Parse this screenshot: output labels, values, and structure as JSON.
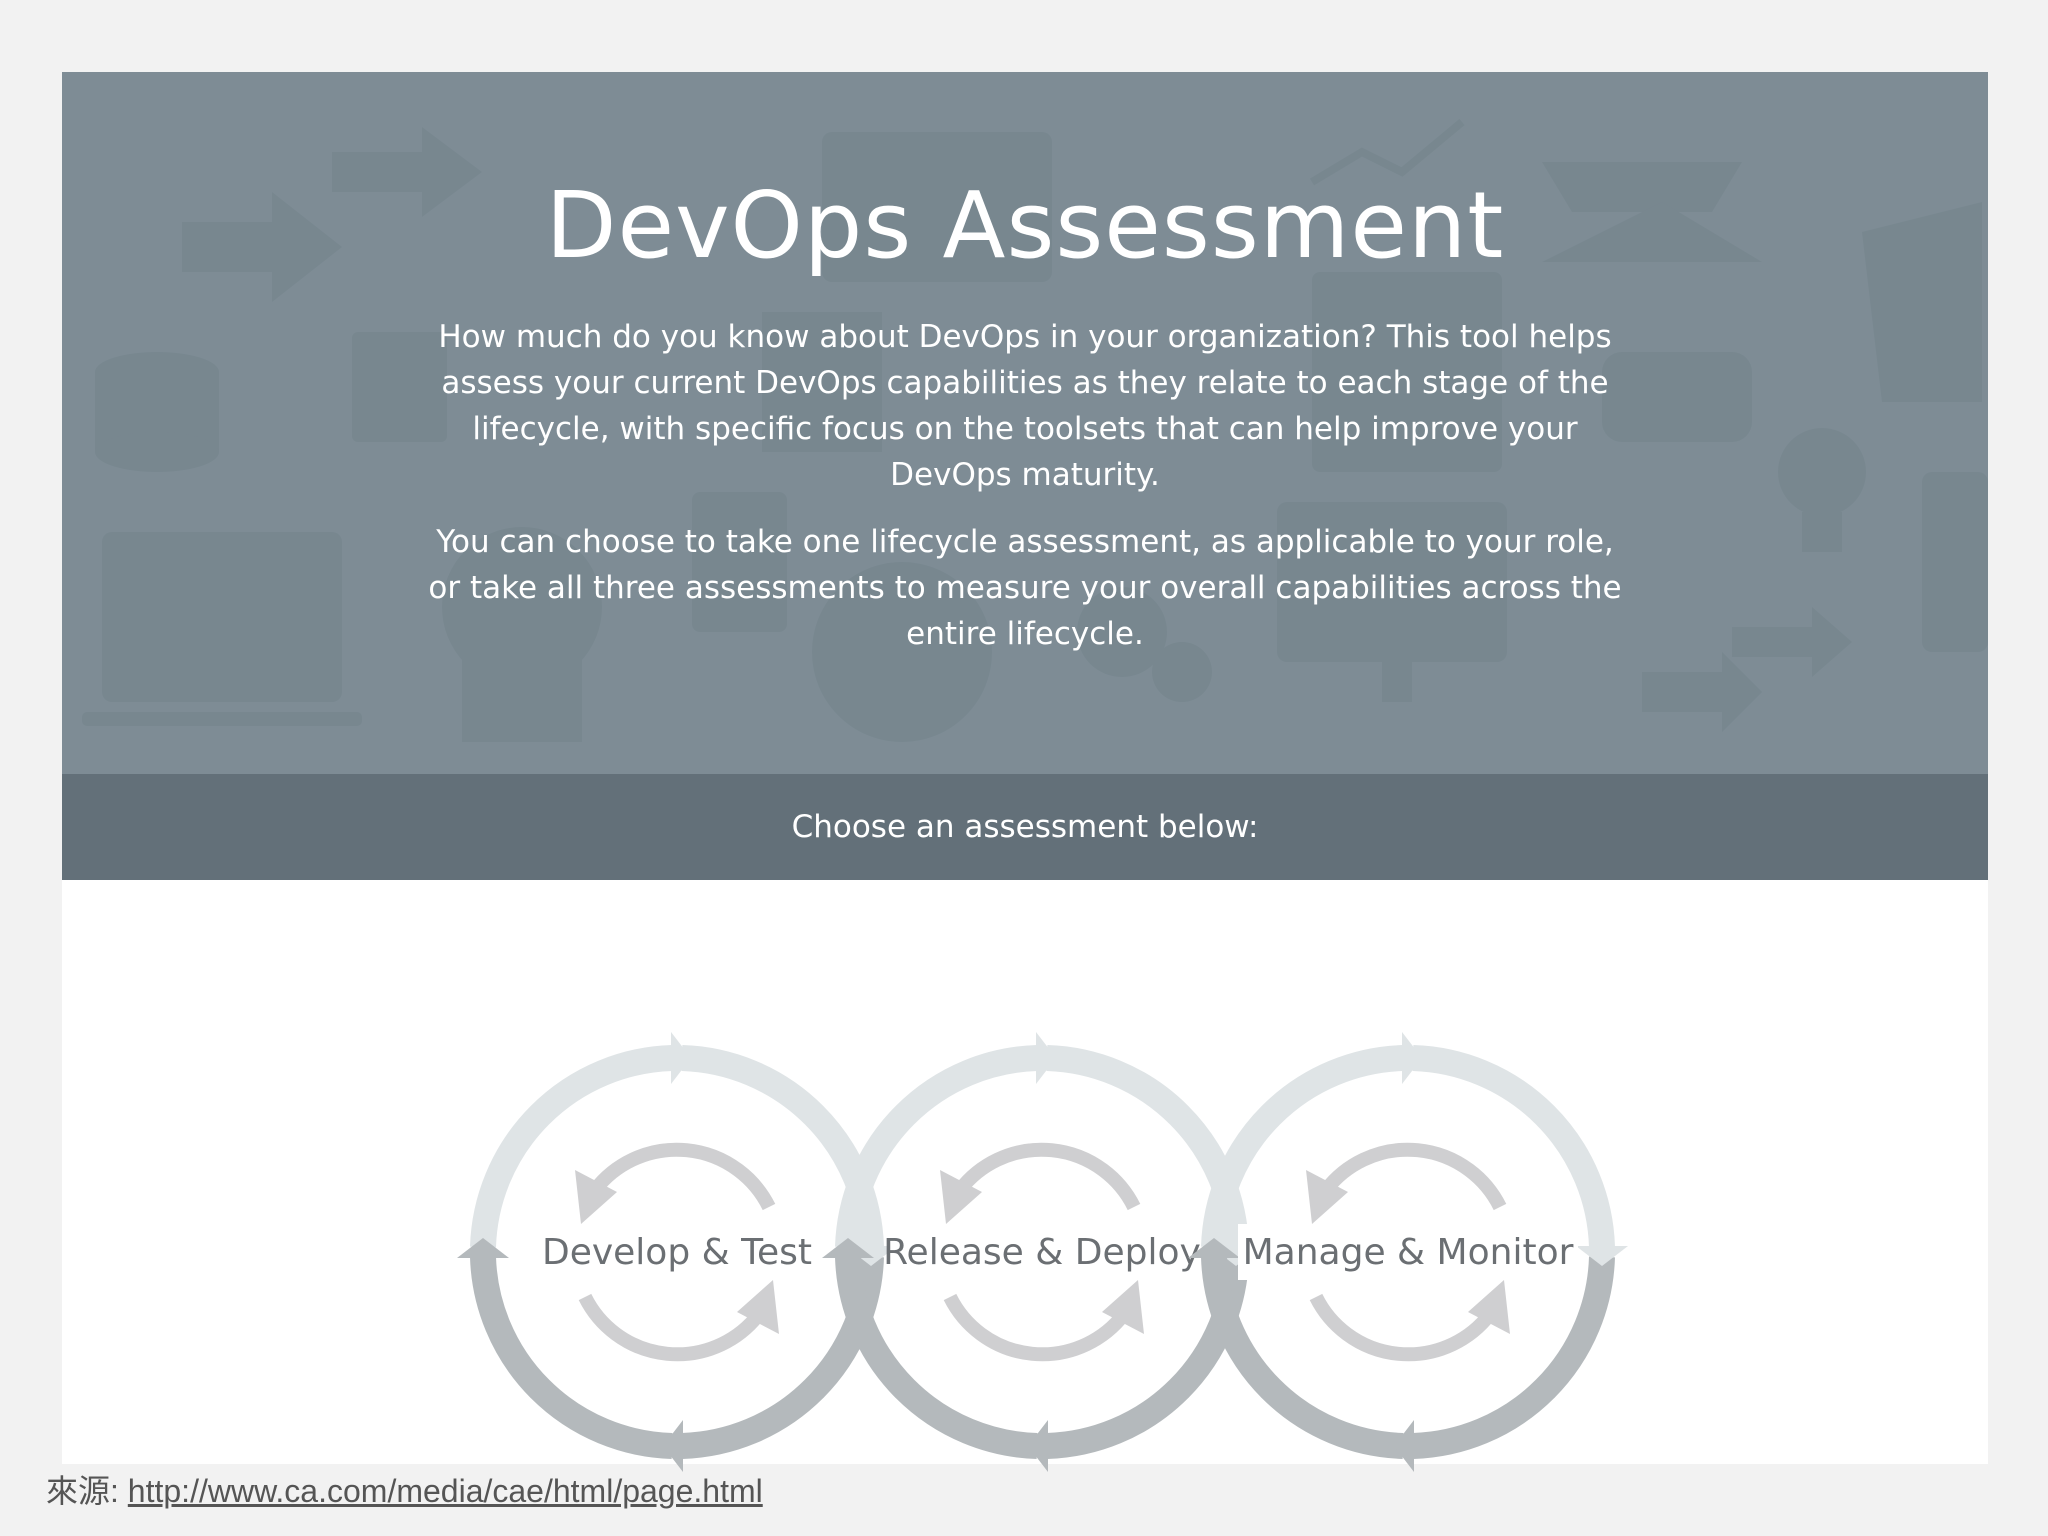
{
  "hero": {
    "title": "DevOps Assessment",
    "paragraph_1": "How much do you know about DevOps in your organization? This tool helps assess your current DevOps capabilities as they relate to each stage of the lifecycle, with specific focus on the toolsets that can help improve your DevOps maturity.",
    "paragraph_2": "You can choose to take one lifecycle assessment, as applicable to your role, or take all three assessments to measure your overall capabilities across the entire lifecycle."
  },
  "choose_bar": {
    "label": "Choose an assessment below:"
  },
  "assessments": [
    {
      "label": "Develop & Test"
    },
    {
      "label": "Release & Deploy"
    },
    {
      "label": "Manage & Monitor"
    }
  ],
  "source": {
    "prefix": "來源:",
    "link_text": "http://www.ca.com/media/cae/html/page.html"
  },
  "colors": {
    "hero_bg": "#7e8d96",
    "bar_bg": "#637079",
    "ring_light": "#dfe4e6",
    "ring_dark": "#b4b9bc",
    "inner_arrow": "#cfcfd1",
    "label_text": "#6b6f73"
  }
}
